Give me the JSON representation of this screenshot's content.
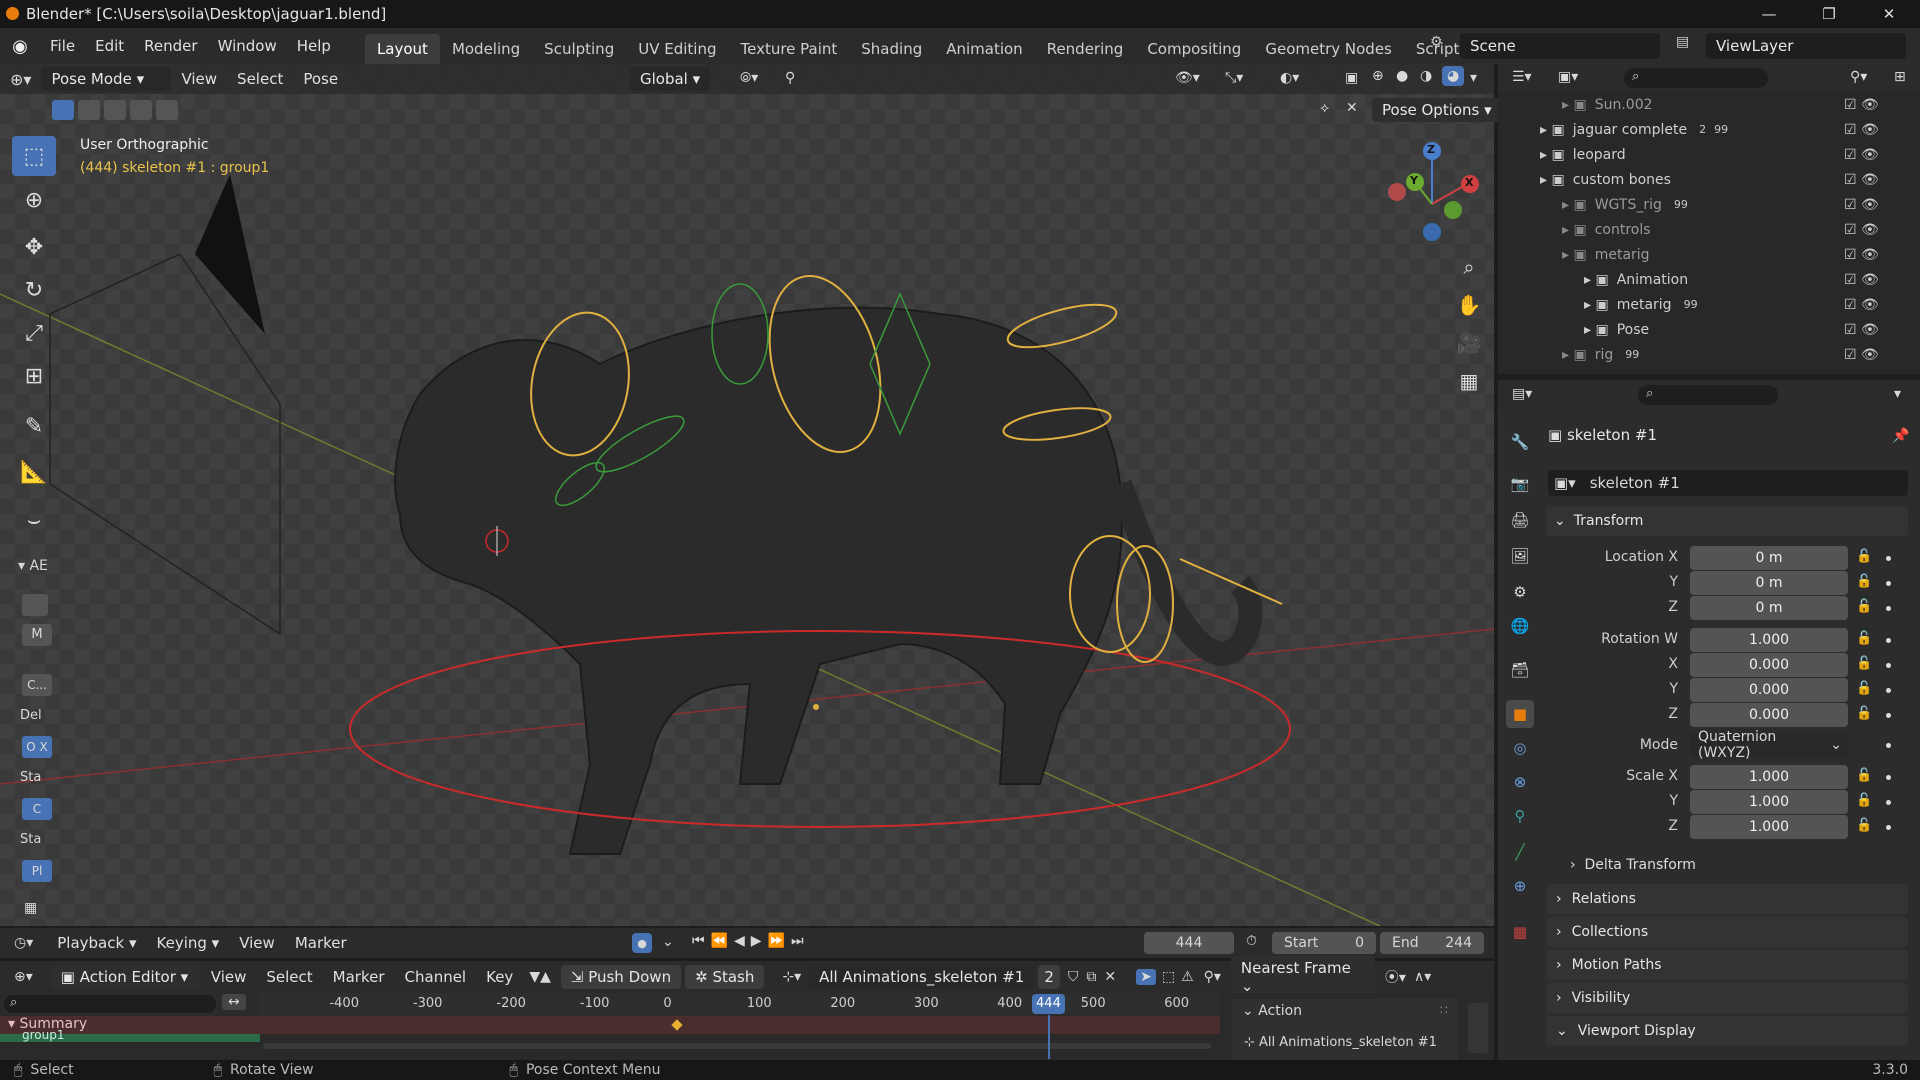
{
  "window": {
    "title": "Blender* [C:\\Users\\soila\\Desktop\\jaguar1.blend]",
    "minimize": "—",
    "maximize": "❐",
    "close": "✕"
  },
  "menus": [
    "File",
    "Edit",
    "Render",
    "Window",
    "Help"
  ],
  "workspaces": [
    "Layout",
    "Modeling",
    "Sculpting",
    "UV Editing",
    "Texture Paint",
    "Shading",
    "Animation",
    "Rendering",
    "Compositing",
    "Geometry Nodes",
    "Scripting",
    "+"
  ],
  "scene": "Scene",
  "view_layer": "ViewLayer",
  "viewport": {
    "mode": "Pose Mode",
    "menus": [
      "View",
      "Select",
      "Pose"
    ],
    "orientation": "Global",
    "pose_options": "Pose Options",
    "view_name": "User Orthographic",
    "context": "(444) skeleton #1 : group1",
    "gizmo_x": "X",
    "gizmo_y": "Y",
    "gizmo_z": "Z",
    "sidebar_labels": [
      "AE",
      "M",
      "C...",
      "Del",
      "O X",
      "Sta",
      "C",
      "Sta",
      "Pl"
    ]
  },
  "outliner": {
    "search_placeholder": "",
    "rows": [
      {
        "name": "Sun.002",
        "indent": 2,
        "dim": true
      },
      {
        "name": "jaguar complete",
        "indent": 1,
        "badge": "2",
        "badge2": "99"
      },
      {
        "name": "leopard",
        "indent": 1
      },
      {
        "name": "custom bones",
        "indent": 1
      },
      {
        "name": "WGTS_rig",
        "indent": 2,
        "dim": true,
        "badge": "99"
      },
      {
        "name": "controls",
        "indent": 2,
        "dim": true
      },
      {
        "name": "metarig",
        "indent": 2,
        "dim": true
      },
      {
        "name": "Animation",
        "indent": 3
      },
      {
        "name": "metarig",
        "indent": 3,
        "badge": "99"
      },
      {
        "name": "Pose",
        "indent": 3
      },
      {
        "name": "rig",
        "indent": 2,
        "dim": true,
        "badge": "99"
      }
    ]
  },
  "properties": {
    "object_name": "skeleton #1",
    "data_name": "skeleton #1",
    "transform_title": "Transform",
    "fields": [
      {
        "label": "Location X",
        "value": "0 m"
      },
      {
        "label": "Y",
        "value": "0 m"
      },
      {
        "label": "Z",
        "value": "0 m"
      },
      {
        "label": "Rotation W",
        "value": "1.000"
      },
      {
        "label": "X",
        "value": "0.000"
      },
      {
        "label": "Y",
        "value": "0.000"
      },
      {
        "label": "Z",
        "value": "0.000"
      }
    ],
    "mode_label": "Mode",
    "mode_value": "Quaternion (WXYZ)",
    "scale": [
      {
        "label": "Scale X",
        "value": "1.000"
      },
      {
        "label": "Y",
        "value": "1.000"
      },
      {
        "label": "Z",
        "value": "1.000"
      }
    ],
    "delta_transform": "Delta Transform",
    "panels": [
      "Relations",
      "Collections",
      "Motion Paths",
      "Visibility",
      "Viewport Display"
    ]
  },
  "timeline": {
    "menus": [
      "Playback",
      "Keying",
      "View",
      "Marker"
    ],
    "current_frame": "444",
    "start_label": "Start",
    "start_value": "0",
    "end_label": "End",
    "end_value": "244"
  },
  "action_editor": {
    "mode": "Action Editor",
    "menus": [
      "View",
      "Select",
      "Marker",
      "Channel",
      "Key"
    ],
    "push_down": "Push Down",
    "stash": "Stash",
    "action_name": "All Animations_skeleton #1",
    "users": "2",
    "snap": "Nearest Frame",
    "ticks": [
      "-400",
      "-300",
      "-200",
      "-100",
      "0",
      "100",
      "200",
      "300",
      "400",
      "500",
      "600"
    ],
    "current": "444",
    "summary": "Summary",
    "group": "group1",
    "side_panel_title": "Action",
    "side_panel_action": "All Animations_skeleton #1"
  },
  "statusbar": {
    "select": "Select",
    "rotate": "Rotate View",
    "context": "Pose Context Menu",
    "version": "3.3.0"
  },
  "colors": {
    "accent": "#4772b3",
    "bone_yellow": "#e0b040",
    "bone_green": "#3a9a3a",
    "ring_red": "#cc2a2a"
  }
}
